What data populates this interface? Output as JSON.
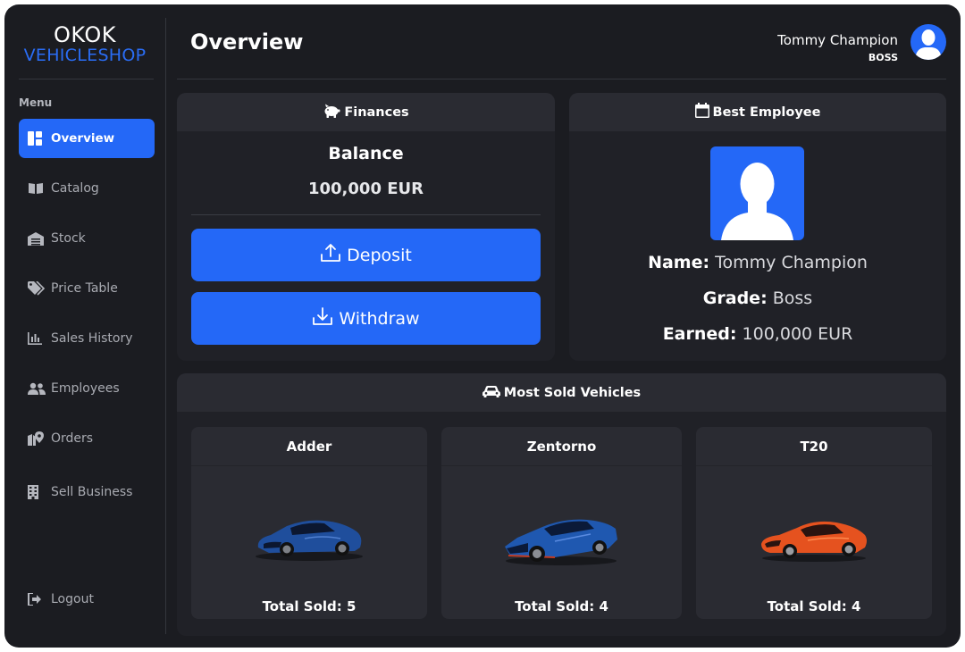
{
  "brand": {
    "top": "OKOK",
    "bottom": "VEHICLESHOP",
    "accent_color": "#2468f7"
  },
  "sidebar": {
    "menu_title": "Menu",
    "items": [
      {
        "label": "Overview",
        "icon": "dashboard-icon",
        "active": true
      },
      {
        "label": "Catalog",
        "icon": "book-icon"
      },
      {
        "label": "Stock",
        "icon": "warehouse-icon"
      },
      {
        "label": "Price Table",
        "icon": "tags-icon"
      },
      {
        "label": "Sales History",
        "icon": "bar-chart-icon"
      },
      {
        "label": "Employees",
        "icon": "users-icon"
      },
      {
        "label": "Orders",
        "icon": "map-pin-icon"
      },
      {
        "label": "Sell Business",
        "icon": "building-icon"
      }
    ],
    "logout": {
      "label": "Logout",
      "icon": "sign-out-icon"
    }
  },
  "header": {
    "title": "Overview",
    "user": {
      "name": "Tommy Champion",
      "grade": "BOSS",
      "avatar_icon": "user-avatar-icon"
    }
  },
  "finances": {
    "title": "Finances",
    "icon": "piggy-bank-icon",
    "balance_label": "Balance",
    "balance_value": "100,000 EUR",
    "deposit_label": "Deposit",
    "withdraw_label": "Withdraw"
  },
  "best_employee": {
    "title": "Best Employee",
    "icon": "calendar-icon",
    "name_label": "Name:",
    "name_value": "Tommy Champion",
    "grade_label": "Grade:",
    "grade_value": "Boss",
    "earned_label": "Earned:",
    "earned_value": "100,000 EUR"
  },
  "most_sold": {
    "title": "Most Sold Vehicles",
    "icon": "car-icon",
    "vehicles": [
      {
        "name": "Adder",
        "sold_text": "Total Sold: 5",
        "color": "#1f4e9c"
      },
      {
        "name": "Zentorno",
        "sold_text": "Total Sold: 4",
        "color": "#1f58b0"
      },
      {
        "name": "T20",
        "sold_text": "Total Sold: 4",
        "color": "#e5521f"
      }
    ]
  }
}
